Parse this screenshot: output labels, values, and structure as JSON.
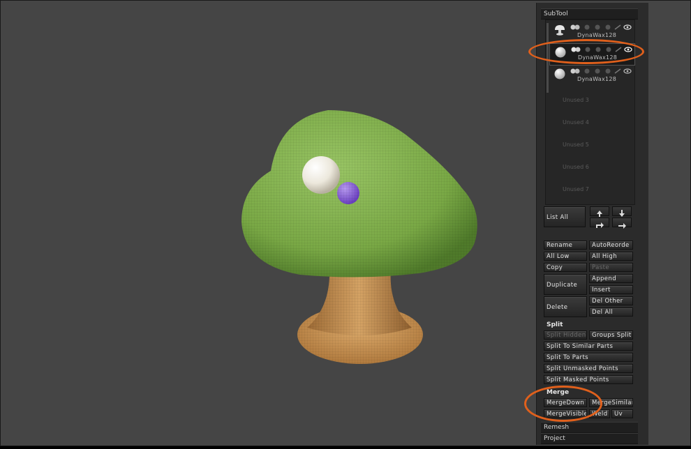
{
  "colors": {
    "viewport_bg": "#454545",
    "highlight_ring": "#e0601c",
    "cap_green": "#7fae4a",
    "stem_tan": "#c99555"
  },
  "viewport": {
    "model": "mushroom-3d-model"
  },
  "subtool": {
    "title": "SubTool",
    "items": [
      {
        "name": "DynaWax128",
        "icon": "mushroom-icon"
      },
      {
        "name": "DynaWax128",
        "icon": "sphere-icon"
      },
      {
        "name": "DynaWax128",
        "icon": "sphere-icon"
      }
    ],
    "unused": [
      "Unused 3",
      "Unused 4",
      "Unused 5",
      "Unused 6",
      "Unused 7"
    ],
    "list_all": "List All",
    "buttons": {
      "rename": "Rename",
      "auto_reorder": "AutoReorde",
      "all_low": "All Low",
      "all_high": "All High",
      "copy": "Copy",
      "paste": "Paste",
      "duplicate": "Duplicate",
      "append": "Append",
      "insert": "Insert",
      "delete": "Delete",
      "del_other": "Del Other",
      "del_all": "Del All"
    },
    "split": {
      "title": "Split",
      "split_hidden": "Split Hidden",
      "groups_split": "Groups Split",
      "similar": "Split To Similar Parts",
      "to_parts": "Split To Parts",
      "unmasked": "Split Unmasked Points",
      "masked": "Split Masked Points"
    },
    "merge": {
      "title": "Merge",
      "merge_down": "MergeDown",
      "merge_similar": "MergeSimilar",
      "merge_visible": "MergeVisible",
      "weld": "Weld",
      "uv": "Uv"
    },
    "remesh": "Remesh",
    "project": "Project"
  }
}
